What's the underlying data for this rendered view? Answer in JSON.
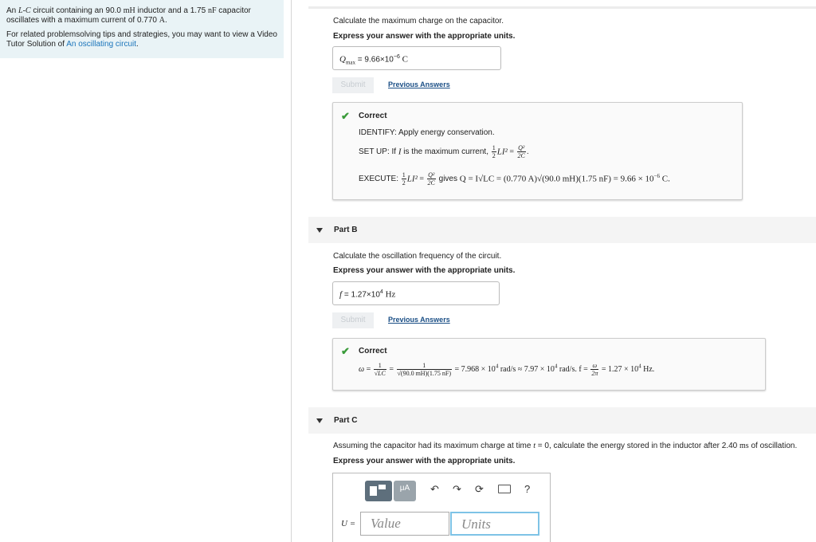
{
  "problem": {
    "text_pre": "An ",
    "lc": "L-C",
    "text_mid1": " circuit containing an 90.0 ",
    "unit_mh": "mH",
    "text_mid2": " inductor and a 1.75 ",
    "unit_nf": "nF",
    "text_mid3": " capacitor oscillates with a maximum current of 0.770 ",
    "unit_a": "A",
    "text_end": ".",
    "tips_text": "For related problemsolving tips and strategies, you may want to view a Video Tutor Solution of ",
    "tips_link": "An oscillating circuit",
    "tips_end": "."
  },
  "part_a": {
    "question": "Calculate the maximum charge on the capacitor.",
    "instruction": "Express your answer with the appropriate units.",
    "answer_label": "Q",
    "answer_sub": "max",
    "answer_eq": " = ",
    "answer_value": "9.66×10",
    "answer_exp": "−6",
    "answer_unit": " C",
    "submit_label": "Submit",
    "previous_label": "Previous Answers",
    "feedback_title": "Correct",
    "identify": "IDENTIFY: Apply energy conservation.",
    "setup_prefix": "SET UP: If ",
    "setup_var": "I",
    "setup_mid": " is the maximum current, ",
    "execute_prefix": "EXECUTE: ",
    "execute_gives": " gives ",
    "execute_formula": "Q = I√LC = (0.770 A)√(90.0 mH)(1.75 nF) = 9.66 × 10",
    "execute_exp": "−6",
    "execute_end": " C."
  },
  "part_b": {
    "title": "Part B",
    "question": "Calculate the oscillation frequency of the circuit.",
    "instruction": "Express your answer with the appropriate units.",
    "answer_label": "f",
    "answer_eq": " = ",
    "answer_value": "1.27×10",
    "answer_exp": "4",
    "answer_unit": " Hz",
    "submit_label": "Submit",
    "previous_label": "Previous Answers",
    "feedback_title": "Correct",
    "omega_denom": "√(90.0 mH)(1.75 nF)",
    "result_1": " = 7.968 × 10",
    "result_1_exp": "4",
    "result_2": " rad/s ≈ 7.97 × 10",
    "result_2_exp": "4",
    "result_3": " rad/s. f = ",
    "result_4": " = 1.27 × 10",
    "result_4_exp": "4",
    "result_5": " Hz."
  },
  "part_c": {
    "title": "Part C",
    "question_pre": "Assuming the capacitor had its maximum charge at time ",
    "question_t": "t",
    "question_mid": " = 0, calculate the energy stored in the inductor after 2.40 ",
    "question_unit": "ms",
    "question_end": " of oscillation.",
    "instruction": "Express your answer with the appropriate units.",
    "answer_label": "U =",
    "value_placeholder": "Value",
    "units_placeholder": "Units",
    "toolbar_units_glyph": "μA",
    "help_glyph": "?"
  }
}
